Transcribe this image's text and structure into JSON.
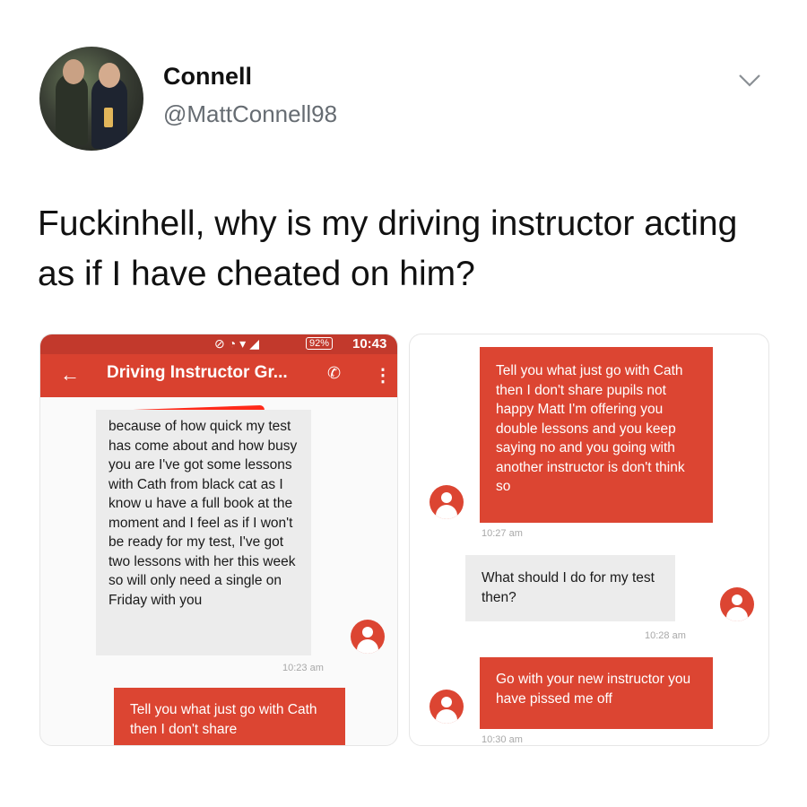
{
  "profile": {
    "name": "Connell",
    "handle": "@MattConnell98"
  },
  "tweet": {
    "text": "Fuckinhell, why is my driving instructor acting as if I have cheated on him?"
  },
  "left_screenshot": {
    "statusbar": {
      "battery": "92%",
      "time": "10:43"
    },
    "chat_title": "Driving Instructor Gr...",
    "msg1": "because of how quick my test has come about and how busy you are I've got some lessons with Cath from black cat as I know u have a full book at the moment and I feel as if I won't be ready for my test, I've got two lessons with her this week so will only need a single on Friday with you",
    "time1": "10:23 am",
    "msg2": "Tell you what just go with Cath then I don't share"
  },
  "right_screenshot": {
    "msg1": "Tell you what just go with Cath then I don't share pupils not happy Matt I'm offering you double lessons and you keep saying no and you going with another instructor is don't think so",
    "time1": "10:27 am",
    "msg2": "What should I do for my test then?",
    "time2": "10:28 am",
    "msg3": "Go with your new instructor you have pissed me off",
    "time3": "10:30 am"
  },
  "colors": {
    "statusbar": "#c2392c",
    "toolbar": "#d9412f",
    "outgoing_bubble": "#dc4532",
    "incoming_bubble": "#ececec"
  },
  "icons": [
    "chevron-down-icon",
    "back-arrow-icon",
    "phone-icon",
    "overflow-menu-icon",
    "contact-avatar-icon"
  ]
}
